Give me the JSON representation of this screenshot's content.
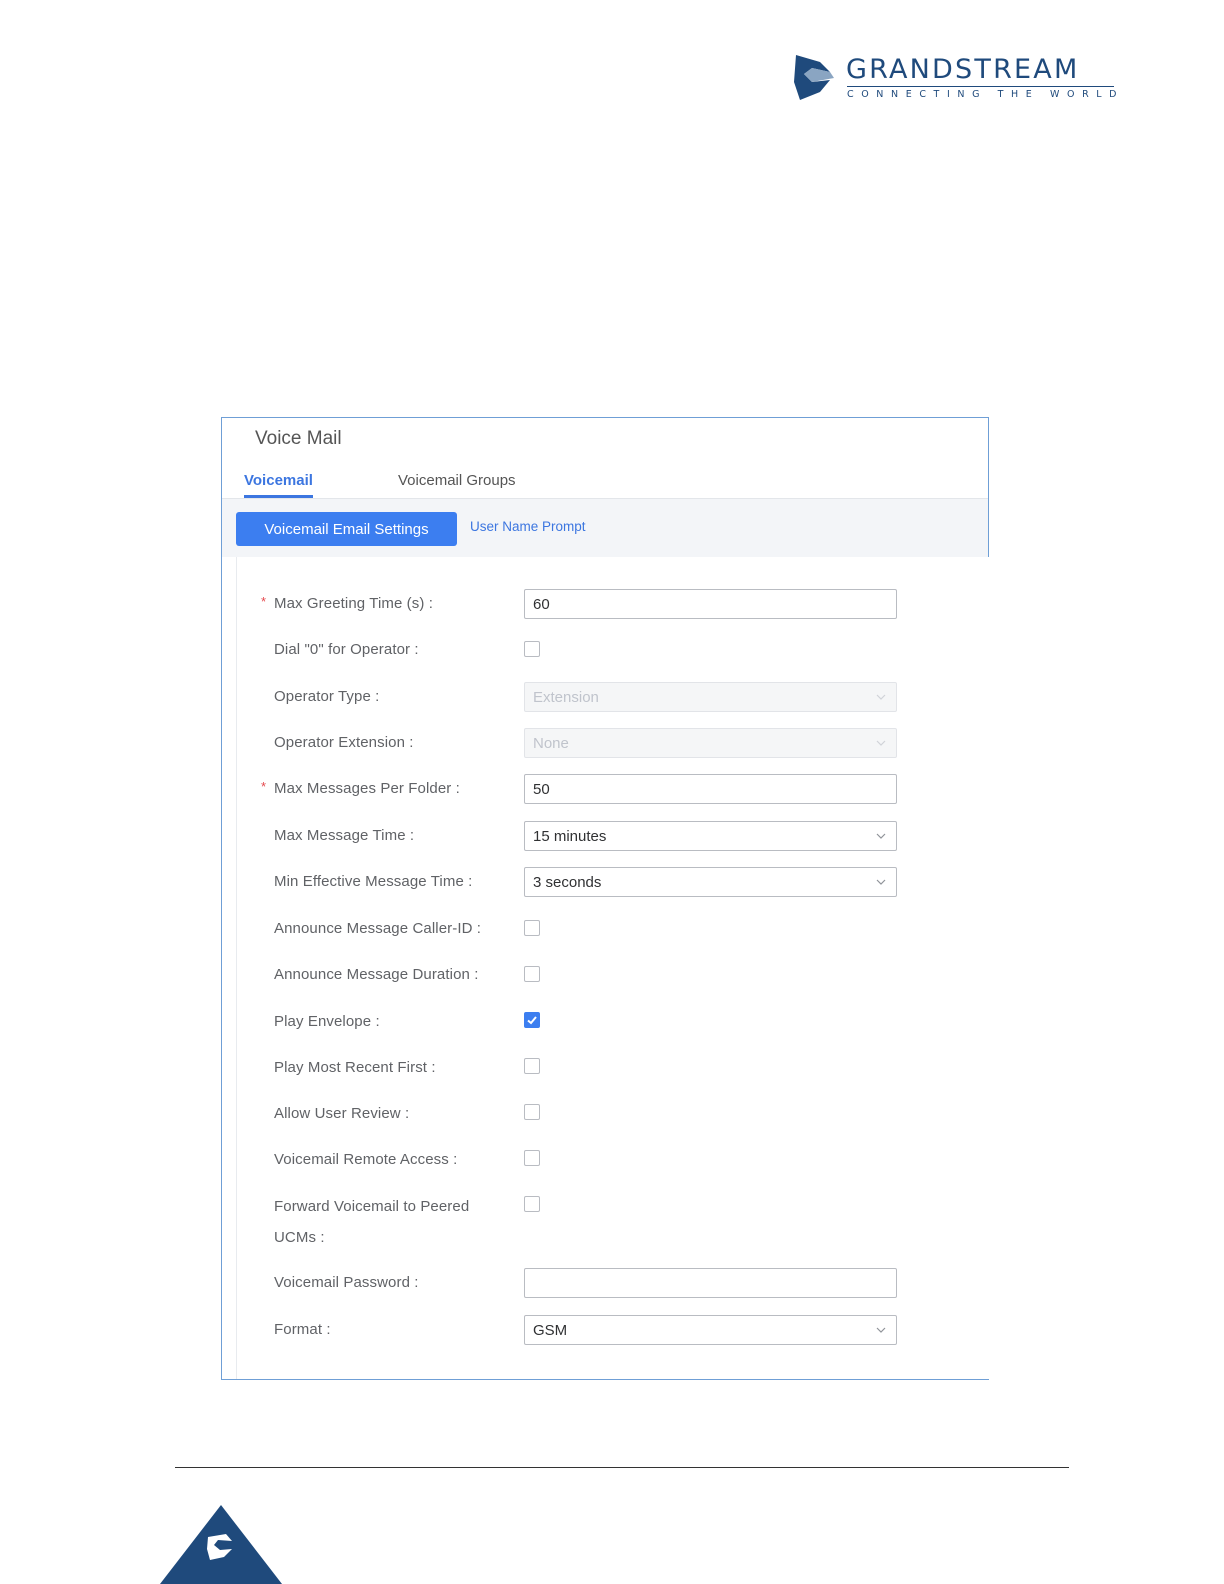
{
  "logo": {
    "brand": "GRANDSTREAM",
    "tagline": "CONNECTING THE WORLD"
  },
  "panel": {
    "title": "Voice Mail",
    "tabs": [
      {
        "label": "Voicemail",
        "active": true
      },
      {
        "label": "Voicemail Groups",
        "active": false
      }
    ],
    "subtabs": [
      {
        "label": "Voicemail Email Settings",
        "active": true
      },
      {
        "label": "User Name Prompt",
        "active": false
      }
    ],
    "form": {
      "max_greeting_time": {
        "label": "Max Greeting Time (s) :",
        "required": true,
        "value": "60"
      },
      "dial_zero_operator": {
        "label": "Dial \"0\" for Operator :",
        "checked": false
      },
      "operator_type": {
        "label": "Operator Type :",
        "value": "Extension",
        "disabled": true
      },
      "operator_extension": {
        "label": "Operator Extension :",
        "value": "None",
        "disabled": true
      },
      "max_messages_per_folder": {
        "label": "Max Messages Per Folder :",
        "required": true,
        "value": "50"
      },
      "max_message_time": {
        "label": "Max Message Time :",
        "value": "15 minutes"
      },
      "min_effective_message_time": {
        "label": "Min Effective Message Time :",
        "value": "3 seconds"
      },
      "announce_caller_id": {
        "label": "Announce Message Caller-ID :",
        "checked": false
      },
      "announce_duration": {
        "label": "Announce Message Duration :",
        "checked": false
      },
      "play_envelope": {
        "label": "Play Envelope :",
        "checked": true
      },
      "play_most_recent_first": {
        "label": "Play Most Recent First :",
        "checked": false
      },
      "allow_user_review": {
        "label": "Allow User Review :",
        "checked": false
      },
      "voicemail_remote_access": {
        "label": "Voicemail Remote Access :",
        "checked": false
      },
      "forward_voicemail_peered": {
        "label": "Forward Voicemail to Peered UCMs :",
        "checked": false
      },
      "voicemail_password": {
        "label": "Voicemail Password :",
        "value": ""
      },
      "format": {
        "label": "Format :",
        "value": "GSM"
      }
    }
  },
  "colors": {
    "accent": "#3c7ef0",
    "brand": "#1f4a7c",
    "required": "#e5484d"
  }
}
